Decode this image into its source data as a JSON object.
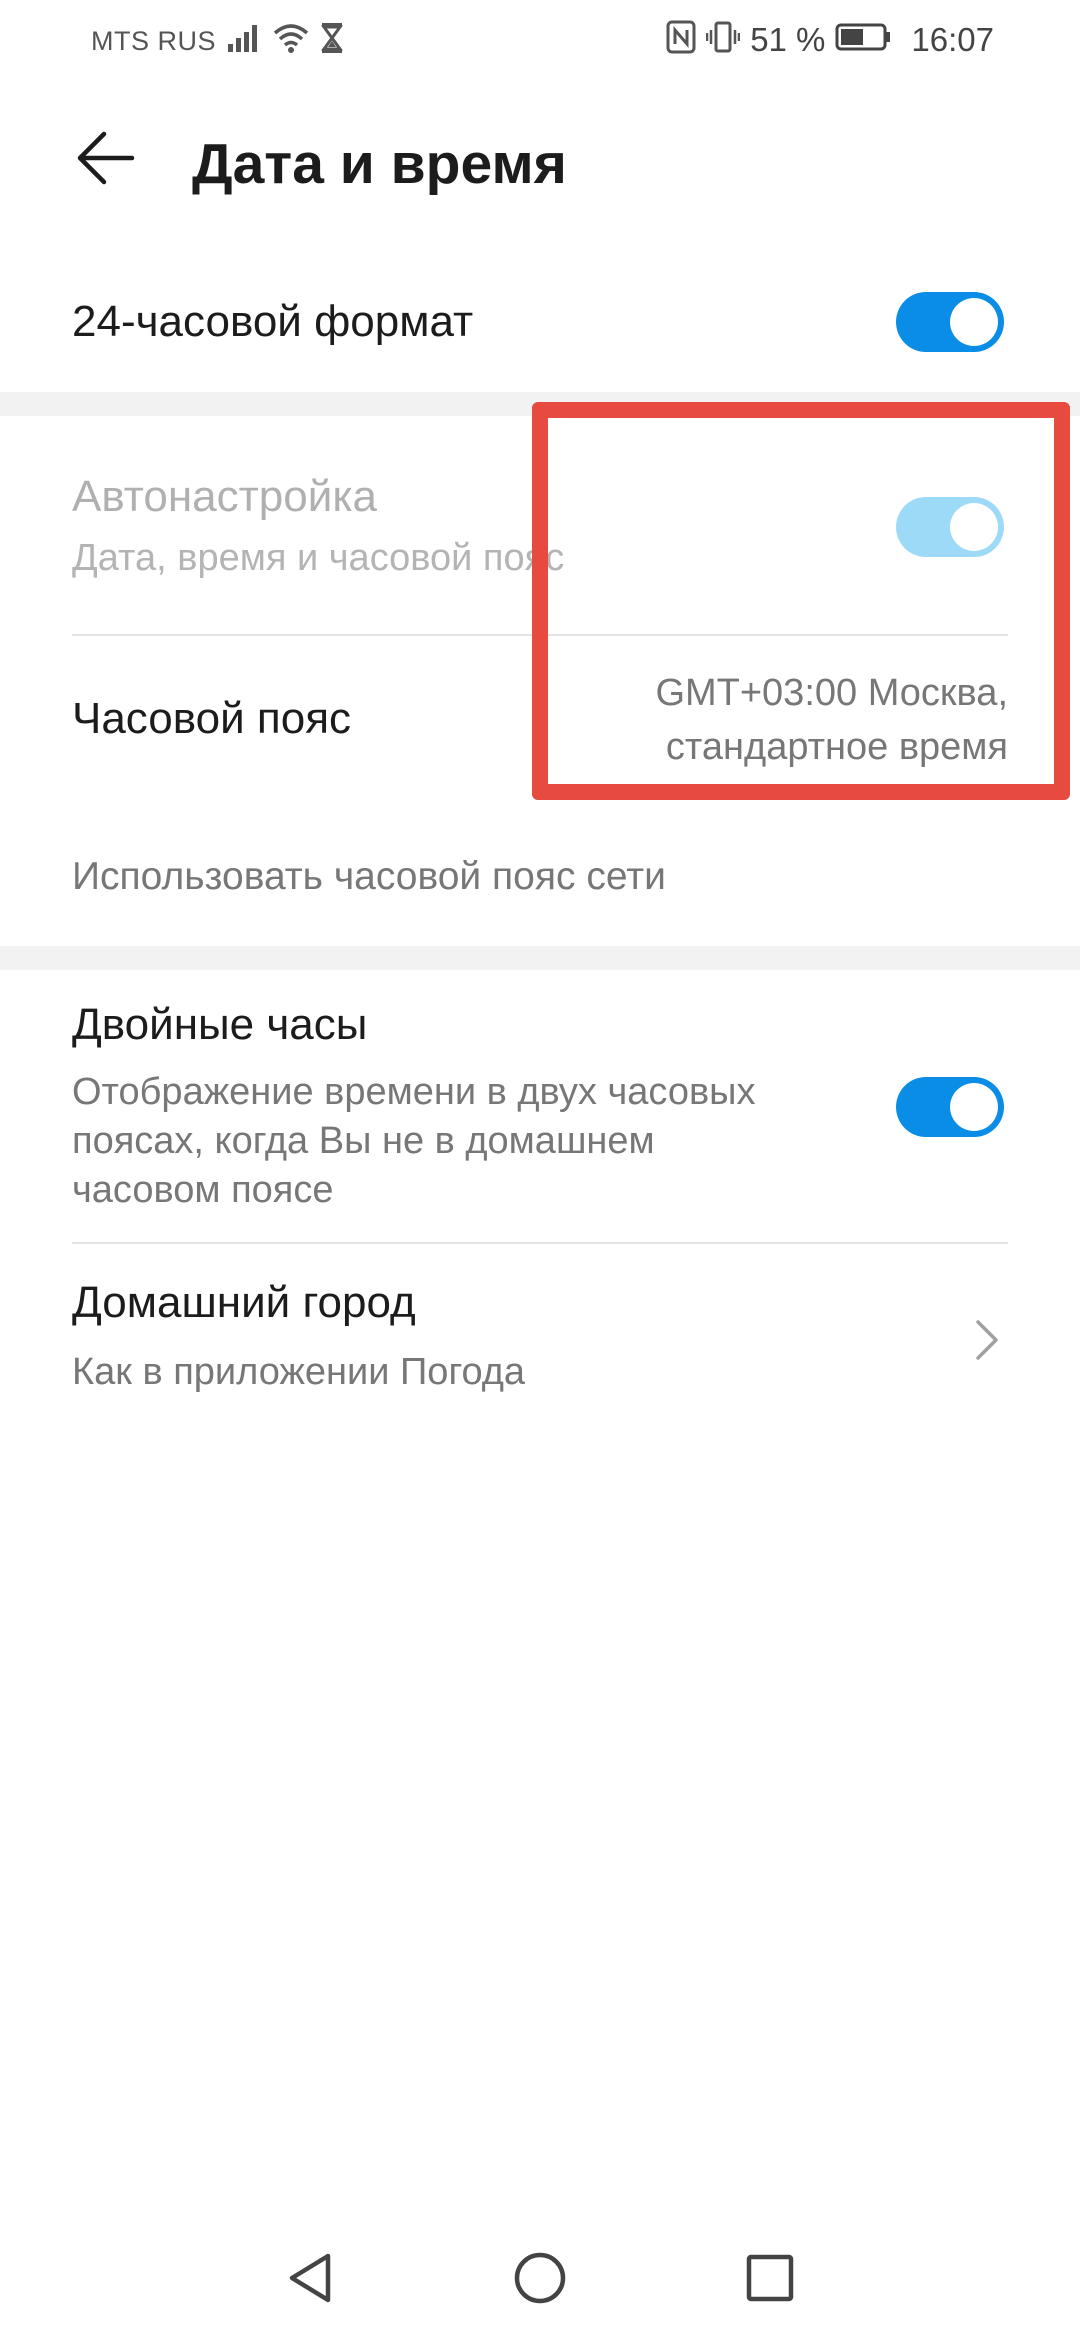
{
  "status_bar": {
    "carrier": "MTS RUS",
    "battery_percent": "51 %",
    "time": "16:07",
    "icons": [
      "signal-icon",
      "wifi-icon",
      "hourglass-icon",
      "nfc-icon",
      "vibrate-icon",
      "battery-icon"
    ]
  },
  "header": {
    "title": "Дата и время",
    "back_icon": "back-arrow-icon"
  },
  "settings": {
    "format_24h": {
      "label": "24-часовой формат",
      "enabled": true
    },
    "auto_setup": {
      "label": "Автонастройка",
      "subtitle": "Дата, время и часовой пояс",
      "enabled": true,
      "disabled_state": true
    },
    "timezone": {
      "label": "Часовой пояс",
      "value_line1": "GMT+03:00 Москва,",
      "value_line2": "стандартное время"
    },
    "network_timezone": {
      "label": "Использовать часовой пояс сети"
    },
    "dual_clock": {
      "label": "Двойные часы",
      "subtitle_line1": "Отображение времени в двух часовых",
      "subtitle_line2": "поясах, когда Вы не в домашнем",
      "subtitle_line3": "часовом поясе",
      "enabled": true
    },
    "home_city": {
      "label": "Домашний город",
      "subtitle": "Как в приложении Погода"
    }
  },
  "colors": {
    "toggle_on": "#0a8de6",
    "toggle_dim": "#9ddaf8",
    "highlight": "#e74a3f",
    "band": "#f2f2f2"
  },
  "nav": {
    "icons": [
      "back-triangle-icon",
      "home-circle-icon",
      "recents-square-icon"
    ]
  }
}
